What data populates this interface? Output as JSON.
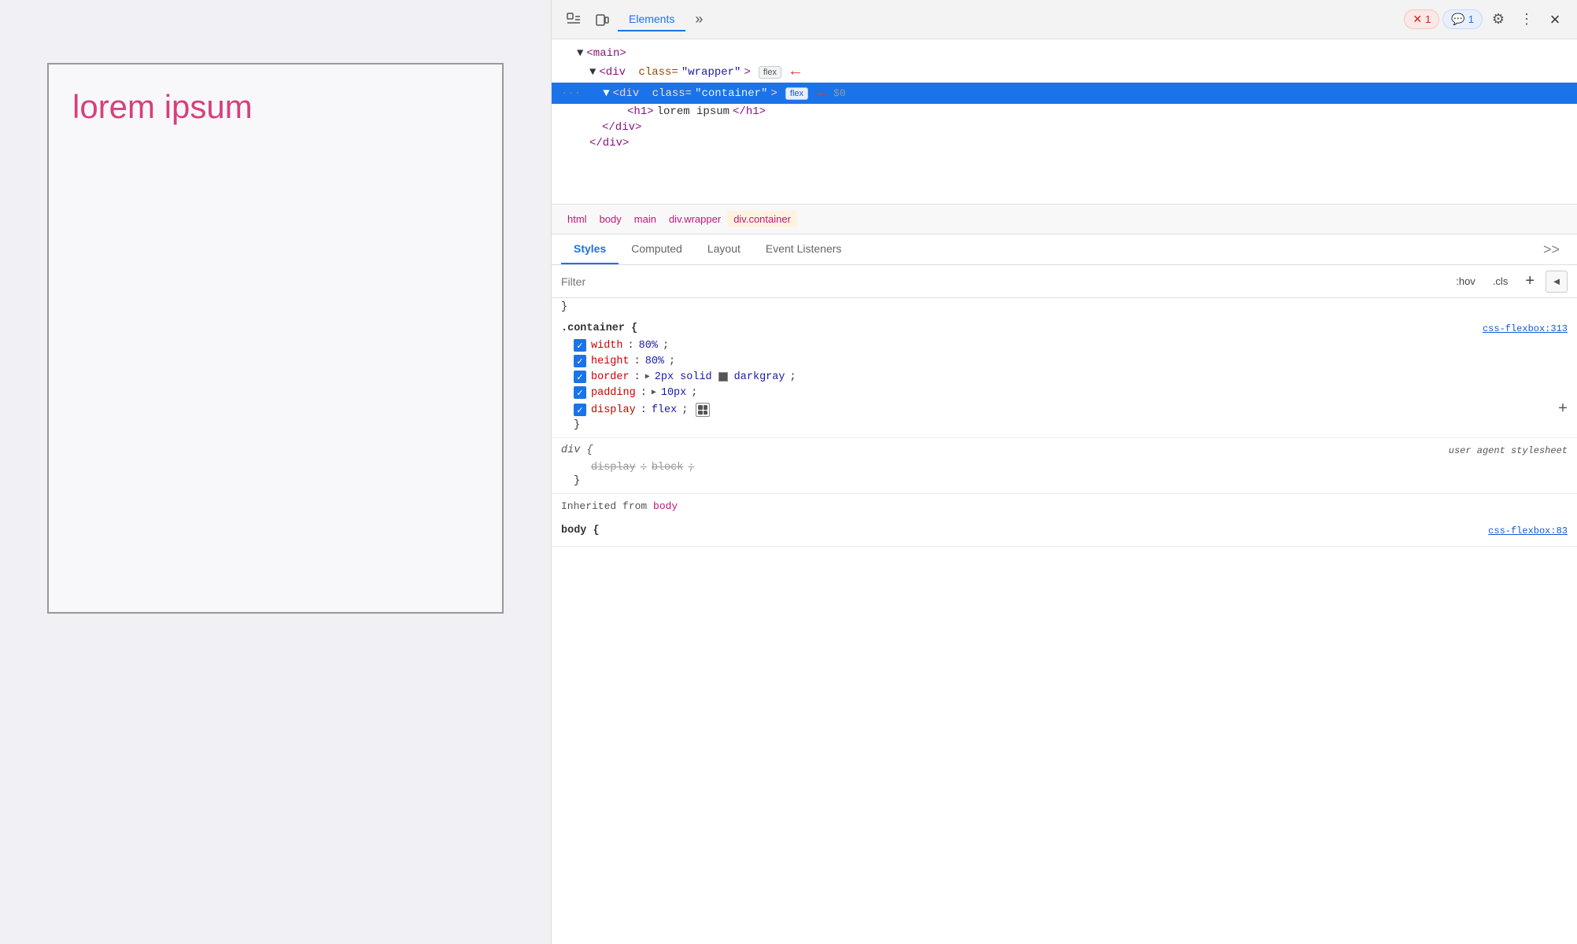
{
  "webpage": {
    "lorem_text": "lorem ipsum"
  },
  "devtools": {
    "header": {
      "inspect_icon": "⬚",
      "device_icon": "▭",
      "elements_tab": "Elements",
      "more_tabs_icon": "»",
      "error_badge": "1",
      "info_badge": "1",
      "settings_icon": "⚙",
      "more_icon": "⋮",
      "close_icon": "×"
    },
    "dom": {
      "lines": [
        {
          "indent": 0,
          "content": "▼<main>",
          "selected": false,
          "flex_badge": "",
          "arrow": false
        },
        {
          "indent": 1,
          "content": "▼<div class=\"wrapper\">",
          "selected": false,
          "flex_badge": "flex",
          "arrow": true
        },
        {
          "indent": 2,
          "content": "▼<div class=\"container\">",
          "selected": true,
          "flex_badge": "flex",
          "arrow": true
        },
        {
          "indent": 3,
          "content": "<h1>lorem ipsum</h1>",
          "selected": false,
          "flex_badge": "",
          "arrow": false
        },
        {
          "indent": 2,
          "content": "</div>",
          "selected": false,
          "flex_badge": "",
          "arrow": false
        },
        {
          "indent": 1,
          "content": "</div>",
          "selected": false,
          "flex_badge": "",
          "arrow": false
        }
      ]
    },
    "breadcrumb": {
      "items": [
        "html",
        "body",
        "main",
        "div.wrapper",
        "div.container"
      ]
    },
    "style_tabs": {
      "tabs": [
        "Styles",
        "Computed",
        "Layout",
        "Event Listeners"
      ],
      "active": "Styles",
      "more": ">>"
    },
    "filter": {
      "placeholder": "Filter",
      "hov_btn": ":hov",
      "cls_btn": ".cls",
      "add_btn": "+",
      "toggle_btn": "◄"
    },
    "css_rules": {
      "container_rule": {
        "selector": ".container {",
        "source": "css-flexbox:313",
        "properties": [
          {
            "prop": "width",
            "val": "80%",
            "checked": true
          },
          {
            "prop": "height",
            "val": "80%",
            "checked": true
          },
          {
            "prop": "border",
            "val": "2px solid",
            "checked": true,
            "has_color": true,
            "color_label": "darkgray",
            "color_hex": "#555"
          },
          {
            "prop": "padding",
            "val": "10px",
            "checked": true,
            "has_triangle": true
          },
          {
            "prop": "display",
            "val": "flex",
            "checked": true,
            "has_flex_icon": true
          }
        ],
        "close_brace": "}"
      },
      "div_ua_rule": {
        "selector": "div {",
        "source": "user agent stylesheet",
        "properties": [
          {
            "prop": "display",
            "val": "block",
            "strikethrough": true
          }
        ],
        "close_brace": "}"
      }
    },
    "inherited": {
      "label": "Inherited from",
      "from": "body"
    },
    "body_rule_partial": "body {"
  }
}
